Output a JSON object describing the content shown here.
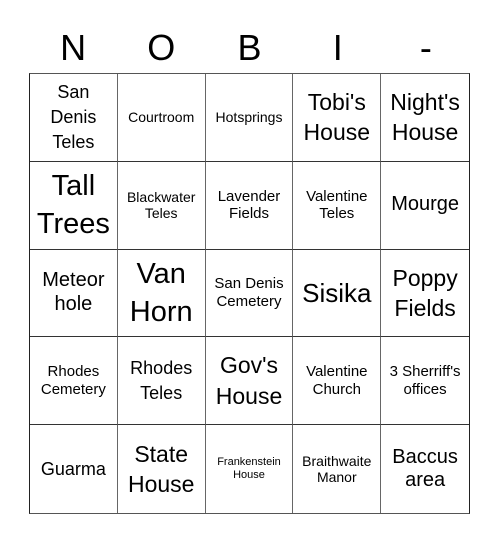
{
  "header": {
    "letters": [
      "N",
      "O",
      "B",
      "I",
      "-"
    ]
  },
  "cells": [
    {
      "text": "San Denis Teles",
      "size": "s18"
    },
    {
      "text": "Courtroom",
      "size": "s13"
    },
    {
      "text": "Hotsprings",
      "size": "s13"
    },
    {
      "text": "Tobi's House",
      "size": "s23"
    },
    {
      "text": "Night's House",
      "size": "s23"
    },
    {
      "text": "Tall Trees",
      "size": "s28"
    },
    {
      "text": "Blackwater Teles",
      "size": "s13"
    },
    {
      "text": "Lavender Fields",
      "size": "s15"
    },
    {
      "text": "Valentine Teles",
      "size": "s15"
    },
    {
      "text": "Mourge",
      "size": "s20"
    },
    {
      "text": "Meteor hole",
      "size": "s20"
    },
    {
      "text": "Van Horn",
      "size": "s28"
    },
    {
      "text": "San Denis Cemetery",
      "size": "s15"
    },
    {
      "text": "Sisika",
      "size": "s26"
    },
    {
      "text": "Poppy Fields",
      "size": "s23"
    },
    {
      "text": "Rhodes Cemetery",
      "size": "s15"
    },
    {
      "text": "Rhodes Teles",
      "size": "s18"
    },
    {
      "text": "Gov's House",
      "size": "s23"
    },
    {
      "text": "Valentine Church",
      "size": "s15"
    },
    {
      "text": "3 Sherriff's offices",
      "size": "s15"
    },
    {
      "text": "Guarma",
      "size": "s18"
    },
    {
      "text": "State House",
      "size": "s23"
    },
    {
      "text": "Frankenstein House",
      "size": "s11"
    },
    {
      "text": "Braithwaite Manor",
      "size": "s13"
    },
    {
      "text": "Baccus area",
      "size": "s20"
    }
  ]
}
